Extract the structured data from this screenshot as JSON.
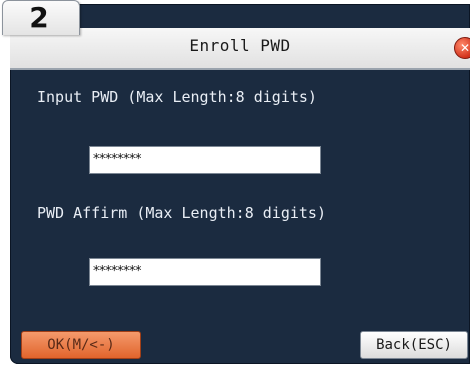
{
  "step_number": "2",
  "window_title": "Enroll PWD",
  "close_icon": "close-icon",
  "fields": [
    {
      "label": "Input PWD (Max Length:8 digits)",
      "value": "********"
    },
    {
      "label": "PWD Affirm (Max Length:8 digits)",
      "value": "********"
    }
  ],
  "buttons": {
    "ok_label": "OK(M/<-)",
    "back_label": "Back(ESC)"
  },
  "colors": {
    "screen_background": "#1b2b40",
    "ok_button": "#e87a45",
    "title_bar": "#ececec"
  }
}
